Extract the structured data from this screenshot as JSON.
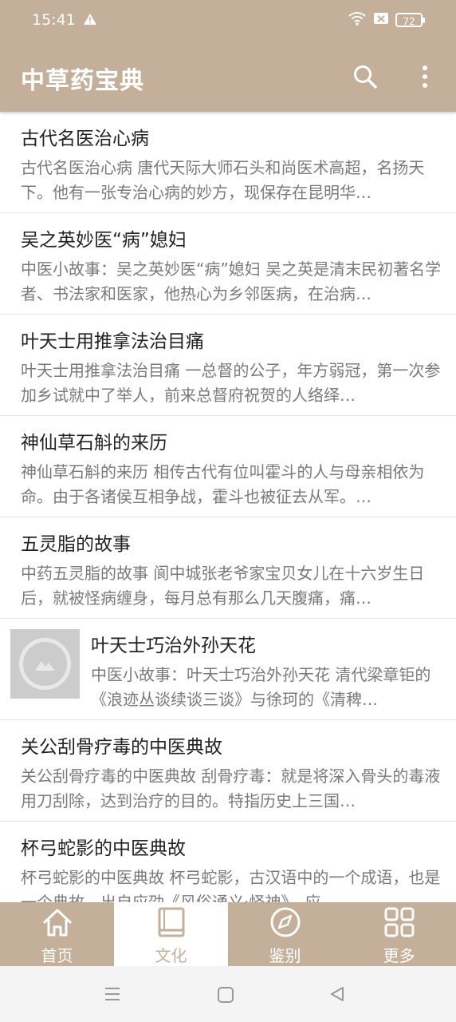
{
  "status_bar": {
    "time": "15:41",
    "battery": "72"
  },
  "app_bar": {
    "title": "中草药宝典",
    "search_icon": "search-icon",
    "more_icon": "more-vert-icon"
  },
  "articles": [
    {
      "title": "古代名医治心病",
      "desc": "古代名医治心病 唐代天际大师石头和尚医术高超，名扬天下。他有一张专治心病的妙方，现保存在昆明华…"
    },
    {
      "title": "吴之英妙医“病”媳妇",
      "desc": "中医小故事：吴之英妙医“病”媳妇 吴之英是清末民初著名学者、书法家和医家，他热心为乡邻医病，在治病…"
    },
    {
      "title": "叶天士用推拿法治目痛",
      "desc": "叶天士用推拿法治目痛 一总督的公子，年方弱冠，第一次参加乡试就中了举人，前来总督府祝贺的人络绎…"
    },
    {
      "title": "神仙草石斛的来历",
      "desc": "神仙草石斛的来历 相传古代有位叫霍斗的人与母亲相依为命。由于各诸侯互相争战，霍斗也被征去从军。…"
    },
    {
      "title": "五灵脂的故事",
      "desc": "中药五灵脂的故事 阆中城张老爷家宝贝女儿在十六岁生日后，就被怪病缠身，每月总有那么几天腹痛，痛…"
    },
    {
      "title": "叶天士巧治外孙天花",
      "desc": "中医小故事：叶天士巧治外孙天花 清代梁章钜的《浪迹丛谈续谈三谈》与徐珂的《清稗…"
    },
    {
      "title": "关公刮骨疗毒的中医典故",
      "desc": "关公刮骨疗毒的中医典故 刮骨疗毒：就是将深入骨头的毒液用刀刮除，达到治疗的目的。特指历史上三国…"
    },
    {
      "title": "杯弓蛇影的中医典故",
      "desc": "杯弓蛇影的中医典故 杯弓蛇影，古汉语中的一个成语，也是一个典故，出自应劭《风俗通义·怪神》。应…"
    }
  ],
  "tabs": [
    {
      "label": "首页",
      "icon": "home-icon"
    },
    {
      "label": "文化",
      "icon": "book-icon",
      "active": true
    },
    {
      "label": "鉴别",
      "icon": "compass-icon"
    },
    {
      "label": "更多",
      "icon": "grid-icon"
    }
  ],
  "colors": {
    "primary": "#c4b09a",
    "title_text": "#222222",
    "desc_text": "#7a7a7a"
  }
}
